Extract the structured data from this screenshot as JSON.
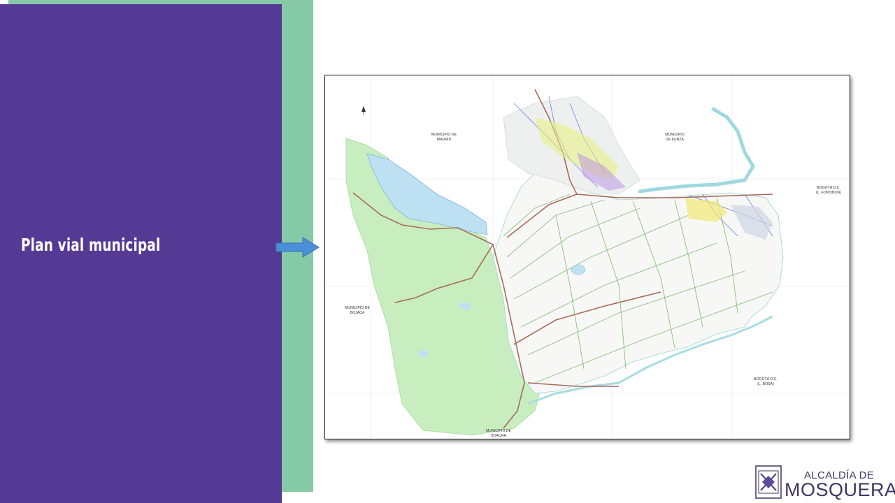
{
  "slide": {
    "title": "Plan vial municipal"
  },
  "map": {
    "labels": {
      "madrid_line1": "MUNICIPIO DE",
      "madrid_line2": "MADRID",
      "funza_line1": "MUNICIPIO",
      "funza_line2": "DE FUNZA",
      "bogota_fontibon_line1": "BOGOTÁ D.C.",
      "bogota_fontibon_line2": "(L. FONTIBON)",
      "bojaca_line1": "MUNICIPIO DE",
      "bojaca_line2": "BOJACA",
      "bogota_bosa_line1": "BOGOTÁ D.C.",
      "bogota_bosa_line2": "(L. BOSA)",
      "soacha_line1": "MUNICIPIO DE",
      "soacha_line2": "SOACHA"
    }
  },
  "logo": {
    "line1": "ALCALDÍA DE",
    "line2": "MOSQUERA"
  },
  "colors": {
    "purple_panel": "#553a95",
    "green_band": "#86c9a6",
    "arrow": "#4a90d9",
    "logo_text": "#3e3563"
  }
}
